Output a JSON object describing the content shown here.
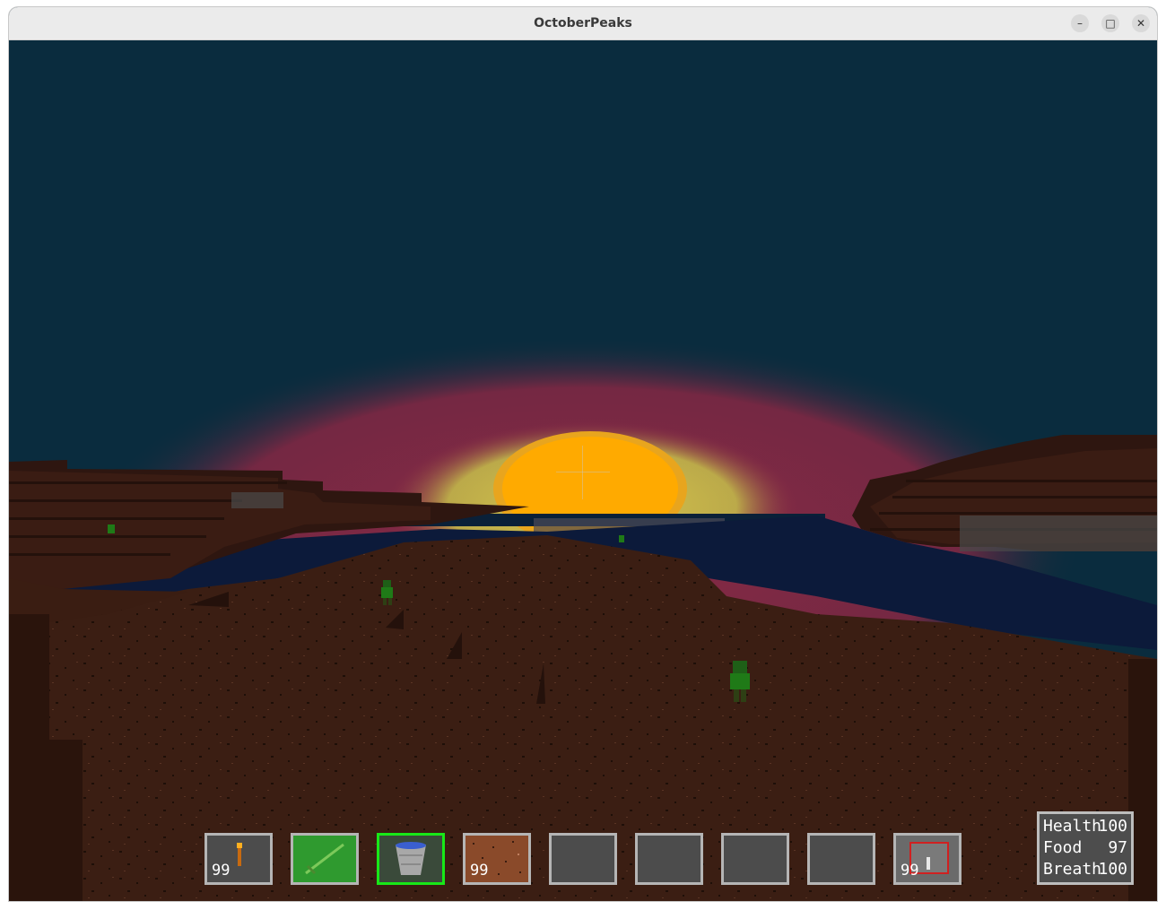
{
  "window": {
    "title": "OctoberPeaks"
  },
  "controls": {
    "minimize": "–",
    "maximize": "□",
    "close": "✕"
  },
  "hotbar": {
    "selected_index": 2,
    "slots": [
      {
        "icon": "torch-icon",
        "count": "99"
      },
      {
        "icon": "sword-icon",
        "count": ""
      },
      {
        "icon": "water-bucket-icon",
        "count": ""
      },
      {
        "icon": "dirt-block-icon",
        "count": "99"
      },
      {
        "icon": "empty-slot",
        "count": ""
      },
      {
        "icon": "empty-slot",
        "count": ""
      },
      {
        "icon": "empty-slot",
        "count": ""
      },
      {
        "icon": "empty-slot",
        "count": ""
      },
      {
        "icon": "furnace-block-icon",
        "count": "99"
      }
    ]
  },
  "stats": {
    "health_label": "Health",
    "health_value": "100",
    "food_label": "Food",
    "food_value": "97",
    "breath_label": "Breath",
    "breath_value": "100"
  },
  "colors": {
    "sky": "#0a2c3e",
    "sun": "#ffaa00",
    "glow_pink": "#8a2a45",
    "glow_yellow": "#c9c24a",
    "water": "#0c1a3a",
    "ground": "#3a1d12",
    "selected_slot": "#18e818"
  }
}
